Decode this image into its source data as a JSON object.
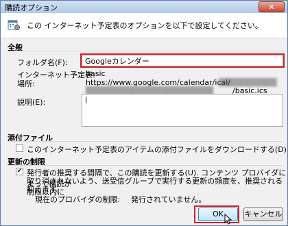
{
  "window": {
    "title": "購読オプション",
    "close_symbol": "✕"
  },
  "header": {
    "text": "この インターネット予定表のオプションを以下で設定してください。",
    "icon": "calendar-options-icon"
  },
  "general": {
    "title": "全般",
    "folder_label": "フォルダ名(F):",
    "folder_value": "Googleカレンダー",
    "calendar_label": "インターネット予定表:",
    "calendar_value": "basic",
    "location_label": "場所:",
    "location_line1": "https://www.google.com/calendar/ical/",
    "location_line2_tail": "/basic.ics",
    "description_label": "説明(E):",
    "description_value": ""
  },
  "attachments": {
    "title": "添付ファイル",
    "checkbox_label": "このインターネット予定表のアイテムの添付ファイルをダウンロードする(D)",
    "checked": false
  },
  "update_limit": {
    "title": "更新の制限",
    "checkbox_line1": "発行者の推奨する間隔で、この購読を更新する(U). コンテンツ プロバイダによって構読が",
    "checkbox_line2": "取り消されないよう、送受信グループで実行する更新の頻度を、推奨される制限以内に",
    "checkbox_line3": "抑えます。",
    "checked": true,
    "provider_limit_label": "現在のプロバイダの制限:",
    "provider_limit_value": "発行されていません。"
  },
  "buttons": {
    "ok": "OK",
    "cancel": "キャンセル"
  },
  "colors": {
    "highlight": "#d8202a",
    "titlebar": "#b3cbe6"
  }
}
